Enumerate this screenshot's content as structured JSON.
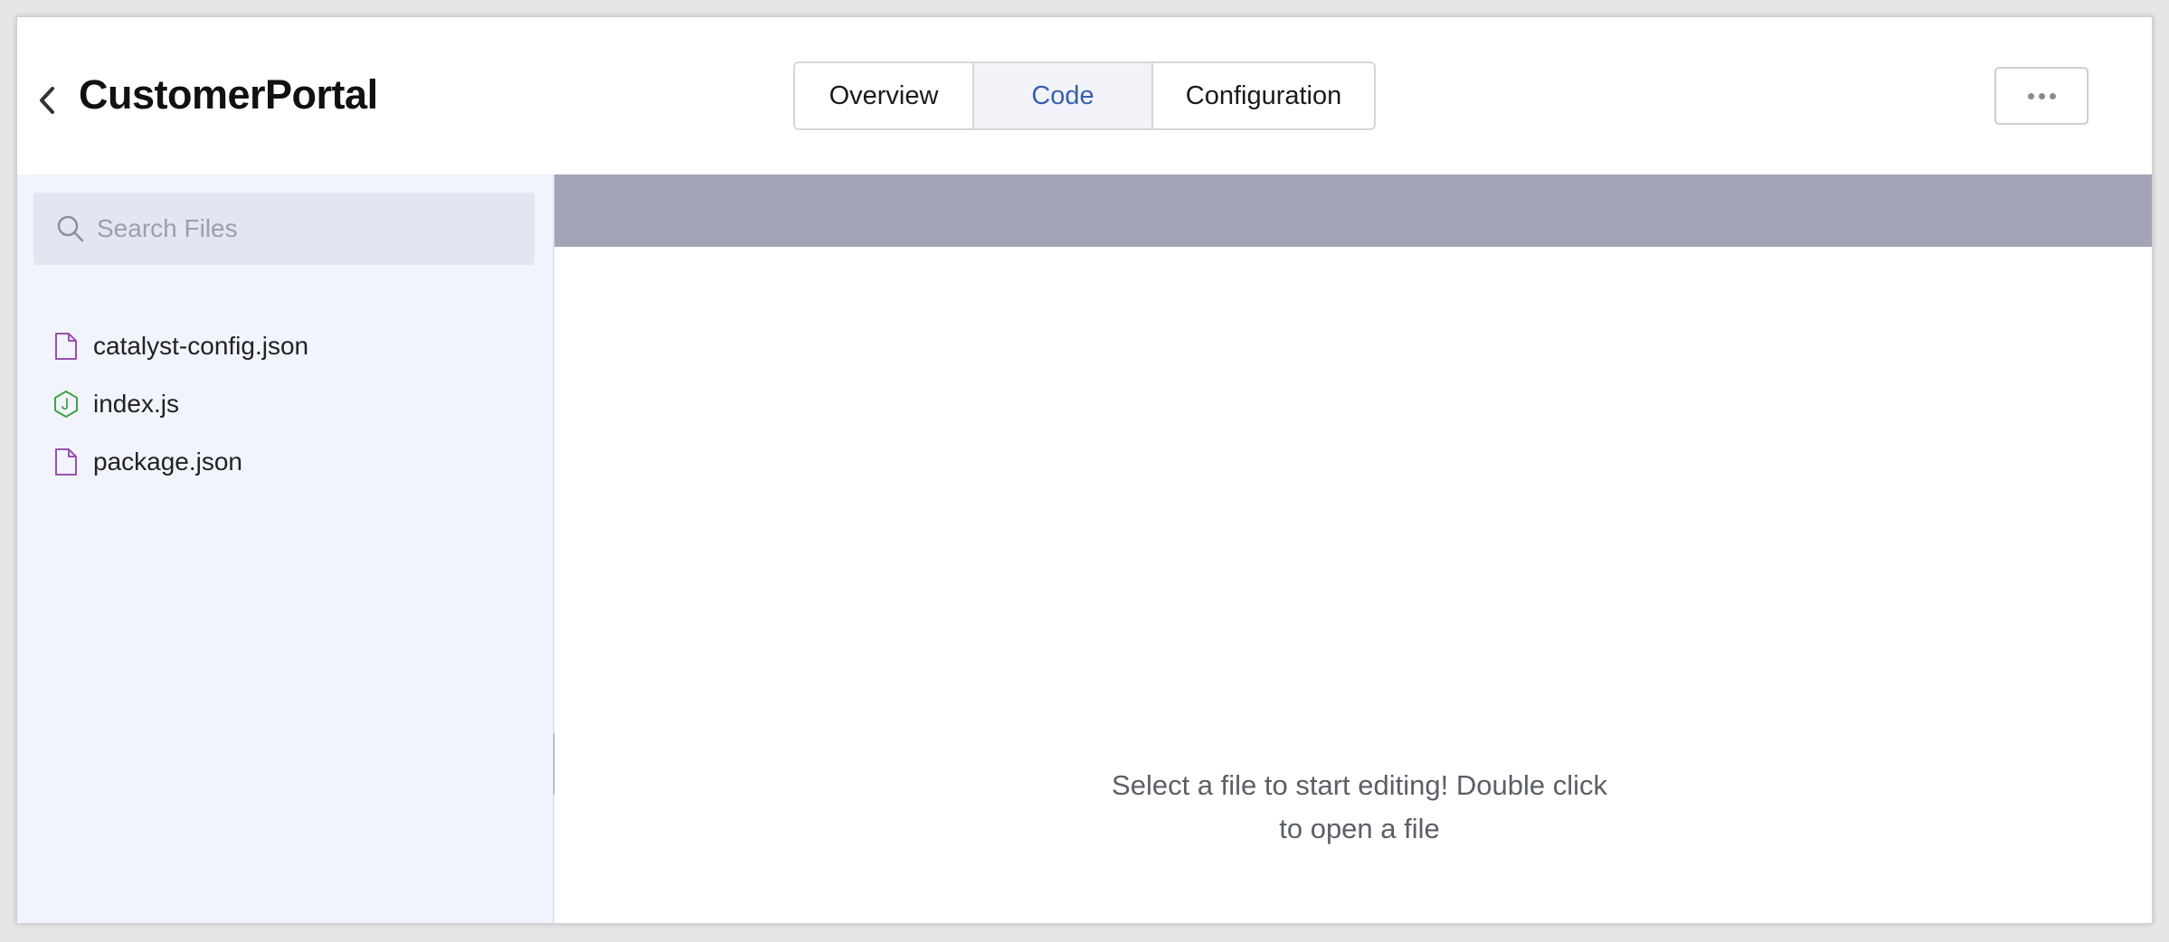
{
  "header": {
    "title": "CustomerPortal",
    "tabs": [
      {
        "label": "Overview",
        "active": false
      },
      {
        "label": "Code",
        "active": true
      },
      {
        "label": "Configuration",
        "active": false
      }
    ]
  },
  "sidebar": {
    "search_placeholder": "Search Files",
    "files": [
      {
        "name": "catalyst-config.json",
        "icon": "file-icon"
      },
      {
        "name": "index.js",
        "icon": "nodejs-icon"
      },
      {
        "name": "package.json",
        "icon": "file-icon"
      }
    ]
  },
  "editor": {
    "empty_line1": "Select a file to start editing! Double click",
    "empty_line2": "to open a file"
  },
  "colors": {
    "active_tab_text": "#3a5fb0",
    "sidebar_bg": "#f1f4fd",
    "tabbar_bg": "#a3a5b6",
    "json_icon": "#9b4fb0",
    "node_icon": "#43a047"
  }
}
